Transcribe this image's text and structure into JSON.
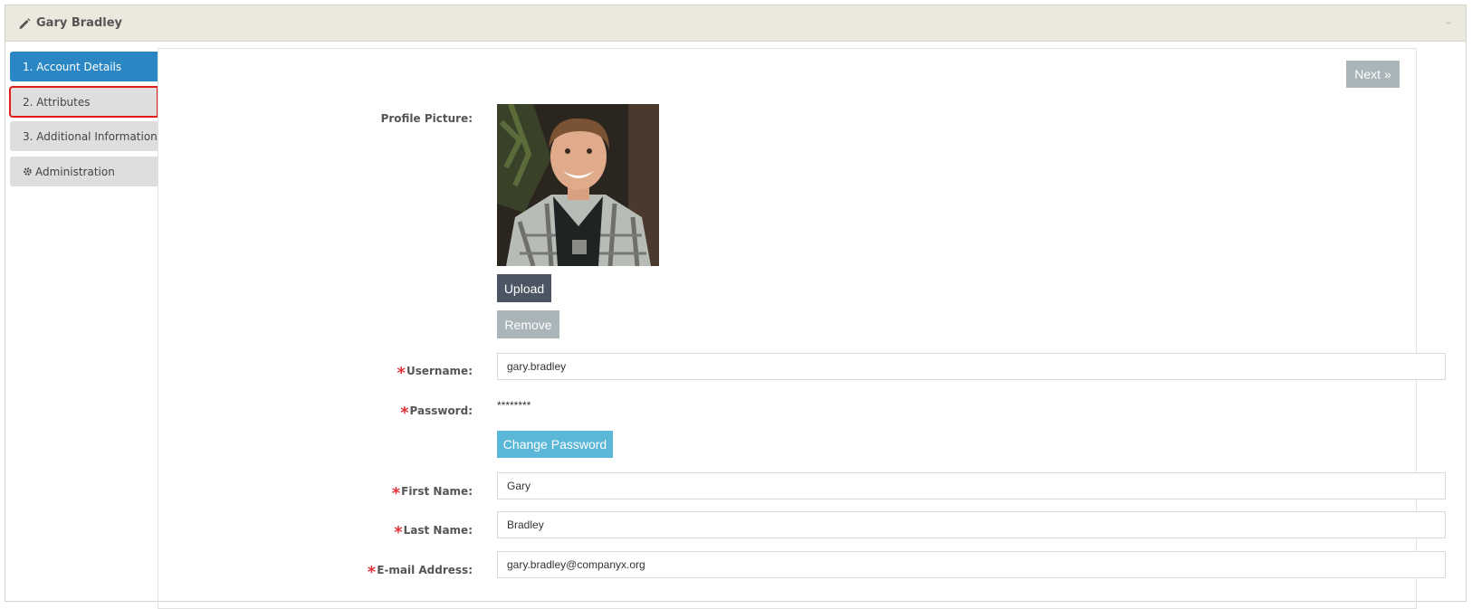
{
  "header": {
    "title": "Gary Bradley",
    "pencil_icon": "pencil-icon",
    "collapse_icon": "chevron-down-icon",
    "collapse_glyph": "⌄"
  },
  "sidebar": {
    "items": [
      {
        "label": "1. Account Details",
        "state": "active"
      },
      {
        "label": "2. Attributes",
        "state": "highlighted"
      },
      {
        "label": "3. Additional Information",
        "state": "default"
      },
      {
        "label": "Administration",
        "icon": "gear-icon",
        "state": "default"
      }
    ]
  },
  "actions": {
    "next_label": "Next »"
  },
  "form": {
    "profile_picture_label": "Profile Picture:",
    "upload_label": "Upload",
    "remove_label": "Remove",
    "username_label": "Username:",
    "username_value": "gary.bradley",
    "password_label": "Password:",
    "password_value": "********",
    "change_password_label": "Change Password",
    "first_name_label": "First Name:",
    "first_name_value": "Gary",
    "last_name_label": "Last Name:",
    "last_name_value": "Bradley",
    "email_label": "E-mail Address:",
    "email_value": "gary.bradley@companyx.org",
    "required_marker": "*"
  },
  "colors": {
    "active_tab": "#2a87c4",
    "highlight_outline": "#e11c1c",
    "required": "#e0343b",
    "upload_button": "#4b5563",
    "muted_button": "#a9b5b8",
    "change_password_button": "#5bb7d8"
  }
}
